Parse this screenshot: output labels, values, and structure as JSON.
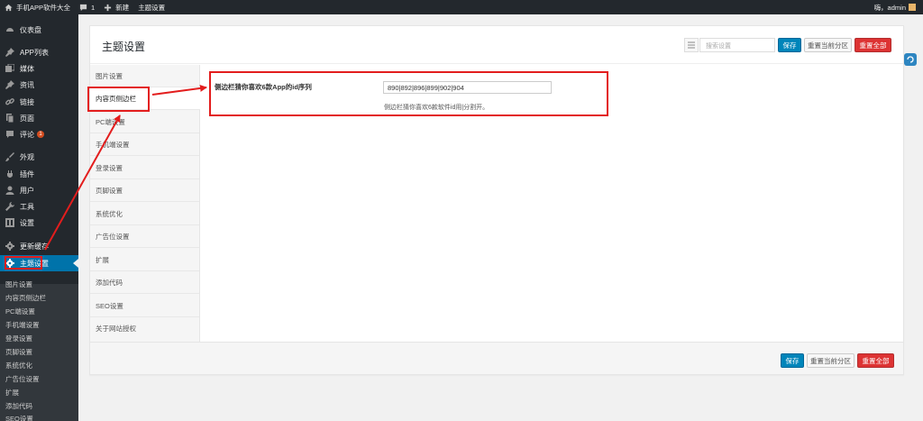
{
  "admin_bar": {
    "site_name": "手机APP软件大全",
    "comment_count": "1",
    "new_label": "新建",
    "theme_settings": "主题设置",
    "greeting": "嗨，admin"
  },
  "sidebar": {
    "items": [
      {
        "label": "仪表盘",
        "icon": "dashboard-icon"
      },
      {
        "label": "APP列表",
        "icon": "pin-icon"
      },
      {
        "label": "媒体",
        "icon": "media-icon"
      },
      {
        "label": "资讯",
        "icon": "pin-icon"
      },
      {
        "label": "链接",
        "icon": "link-icon"
      },
      {
        "label": "页面",
        "icon": "page-icon"
      },
      {
        "label": "评论",
        "icon": "comment-icon",
        "badge": "1"
      },
      {
        "label": "外观",
        "icon": "brush-icon"
      },
      {
        "label": "插件",
        "icon": "plugin-icon"
      },
      {
        "label": "用户",
        "icon": "user-icon"
      },
      {
        "label": "工具",
        "icon": "wrench-icon"
      },
      {
        "label": "设置",
        "icon": "settings-icon"
      },
      {
        "label": "更新缓存",
        "icon": "gear-icon"
      },
      {
        "label": "主题设置",
        "icon": "gear-icon",
        "active": true
      }
    ],
    "submenu": [
      "图片设置",
      "内容页侧边栏",
      "PC端设置",
      "手机端设置",
      "登录设置",
      "页脚设置",
      "系统优化",
      "广告位设置",
      "扩展",
      "添加代码",
      "SEO设置"
    ]
  },
  "panel": {
    "title": "主题设置",
    "search_placeholder": "搜索设置",
    "save_label": "保存",
    "reset_section_label": "重置当前分区",
    "reset_all_label": "重置全部",
    "tabs": [
      "图片设置",
      "内容页侧边栏",
      "PC端设置",
      "手机端设置",
      "登录设置",
      "页脚设置",
      "系统优化",
      "广告位设置",
      "扩展",
      "添加代码",
      "SEO设置",
      "关于网站授权"
    ],
    "active_tab": 1,
    "field": {
      "label": "侧边栏猜你喜欢6款App的id序列",
      "value": "890|892|896|899|902|904",
      "description": "侧边栏猜你喜欢6款软件id用|分割开。"
    }
  },
  "colors": {
    "admin_dark": "#23282d",
    "submenu_bg": "#32373c",
    "accent_blue": "#0073aa",
    "save_blue": "#0085ba",
    "reset_red": "#dd3333",
    "annotation_red": "#e31d1d"
  }
}
